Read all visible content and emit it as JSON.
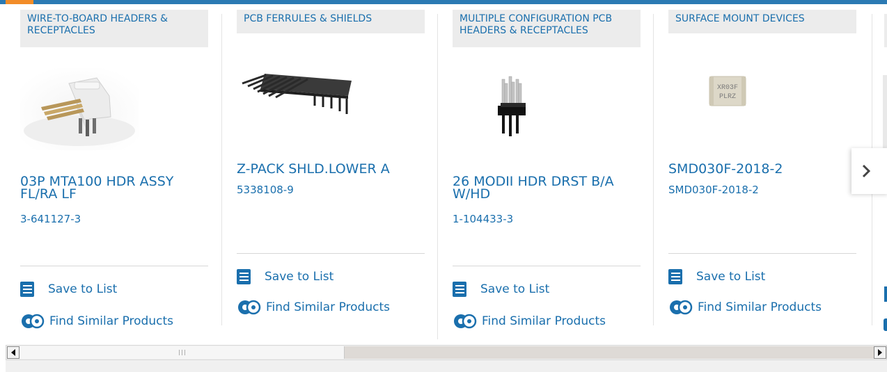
{
  "cards": [
    {
      "category": "WIRE-TO-BOARD HEADERS & RECEPTACLES",
      "name": "03P MTA100 HDR ASSY FL/RA LF",
      "part_number": "3-641127-3",
      "save_label": "Save to List",
      "similar_label": "Find Similar Products"
    },
    {
      "category": "PCB FERRULES & SHIELDS",
      "name": "Z-PACK SHLD.LOWER A",
      "part_number": "5338108-9",
      "save_label": "Save to List",
      "similar_label": "Find Similar Products"
    },
    {
      "category": "MULTIPLE CONFIGURATION PCB HEADERS & RECEPTACLES",
      "name": "26 MODII HDR DRST B/A W/HD",
      "part_number": "1-104433-3",
      "save_label": "Save to List",
      "similar_label": "Find Similar Products"
    },
    {
      "category": "SURFACE MOUNT DEVICES",
      "name": "SMD030F-2018-2",
      "part_number": "SMD030F-2018-2",
      "save_label": "Save to List",
      "similar_label": "Find Similar Products"
    }
  ],
  "smd_chip_text": [
    "XR03F",
    "PLRZ"
  ],
  "colors": {
    "link": "#1a6fad",
    "accent_bar": "#2b7ab3",
    "accent_orange": "#f28c28",
    "tag_background": "#ececec"
  },
  "icons": {
    "list": "save-list-icon",
    "similar": "find-similar-gear-icon",
    "next": "chevron-right-icon",
    "scroll_left": "scroll-left-arrow-icon",
    "scroll_right": "scroll-right-arrow-icon"
  },
  "horizontal_scroll": {
    "thumb_position_fraction": 0.0,
    "visible_fraction": 0.38
  }
}
